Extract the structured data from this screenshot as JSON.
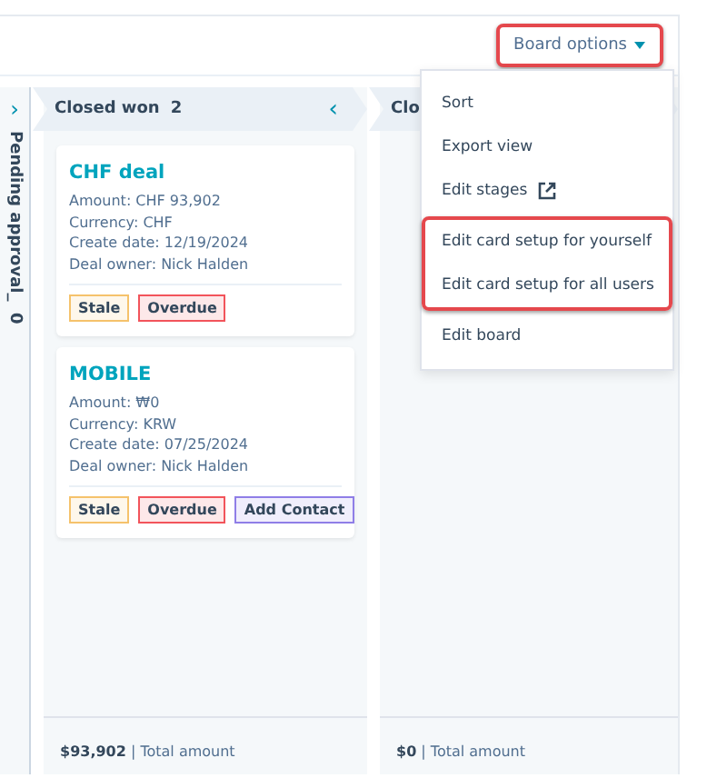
{
  "toolbar": {
    "board_options": {
      "label": "Board options",
      "highlighted": true
    }
  },
  "collapsed_column": {
    "name": "Pending approval_",
    "count": "0",
    "expand_glyph": "›"
  },
  "columns": [
    {
      "name": "Closed won",
      "count": "2",
      "collapse_glyph": "‹",
      "total": "$93,902",
      "total_label": "| Total amount",
      "cards": [
        {
          "title": "CHF deal",
          "lines": [
            "Amount: CHF 93,902",
            "Currency: CHF",
            "Create date: 12/19/2024",
            "Deal owner: Nick Halden"
          ],
          "tags": [
            {
              "label": "Stale",
              "color": "#f5c26b"
            },
            {
              "label": "Overdue",
              "color": "#f2545b"
            }
          ]
        },
        {
          "title": "MOBILE",
          "lines": [
            "Amount: ₩0",
            "Currency: KRW",
            "Create date: 07/25/2024",
            "Deal owner: Nick Halden"
          ],
          "tags": [
            {
              "label": "Stale",
              "color": "#f5c26b"
            },
            {
              "label": "Overdue",
              "color": "#f2545b"
            },
            {
              "label": "Add Contact",
              "color": "#8f7ee7"
            }
          ]
        }
      ]
    },
    {
      "name": "Clo",
      "total": "$0",
      "total_label": "| Total amount"
    }
  ],
  "menu": {
    "sections": [
      {
        "highlighted": false,
        "items": [
          {
            "label": "Sort"
          },
          {
            "label": "Export view"
          },
          {
            "label": "Edit stages",
            "external": true
          }
        ]
      },
      {
        "highlighted": true,
        "items": [
          {
            "label": "Edit card setup for yourself"
          },
          {
            "label": "Edit card setup for all users"
          }
        ]
      },
      {
        "highlighted": false,
        "items": [
          {
            "label": "Edit board"
          }
        ]
      }
    ]
  }
}
